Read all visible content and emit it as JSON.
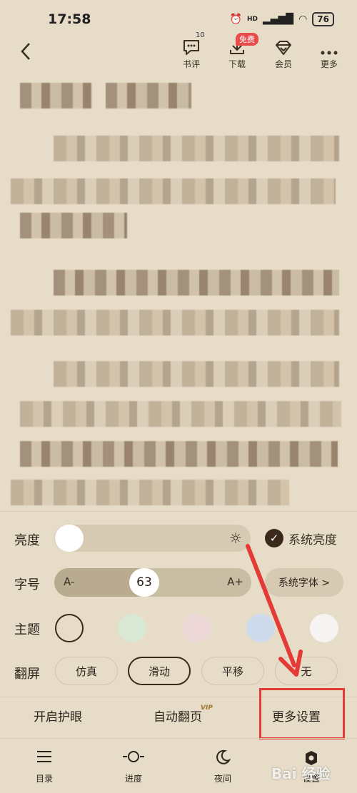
{
  "status_bar": {
    "time": "17:58",
    "alarm_icon": "alarm-icon",
    "hd_label": "HD",
    "signal_icon": "signal-icon",
    "wifi_icon": "wifi-icon",
    "battery": "76"
  },
  "header": {
    "back_icon": "chevron-left-icon",
    "buttons": [
      {
        "label": "书评",
        "icon": "comment-icon",
        "badge": "10"
      },
      {
        "label": "下载",
        "icon": "download-icon",
        "badge": "免费"
      },
      {
        "label": "会员",
        "icon": "diamond-icon"
      },
      {
        "label": "更多",
        "icon": "more-dots-icon"
      }
    ]
  },
  "settings": {
    "brightness": {
      "label": "亮度",
      "level": 0.0,
      "system_label": "系统亮度",
      "system_checked": true
    },
    "font_size": {
      "label": "字号",
      "minus": "A-",
      "plus": "A+",
      "value": "63",
      "font_button": "系统字体 >"
    },
    "theme": {
      "label": "主题",
      "colors": [
        "#e6dcc8",
        "#d8e8d2",
        "#ecd6d6",
        "#cddbec",
        "#f5f4f2"
      ],
      "selected": 0
    },
    "page_turn": {
      "label": "翻屏",
      "options": [
        "仿真",
        "滑动",
        "平移",
        "无"
      ],
      "selected": 1
    }
  },
  "actions": {
    "eye_care": "开启护眼",
    "auto_page": "自动翻页",
    "vip": "VIP",
    "more_settings": "更多设置"
  },
  "bottom_nav": [
    {
      "label": "目录",
      "icon": "menu-lines-icon"
    },
    {
      "label": "进度",
      "icon": "progress-icon"
    },
    {
      "label": "夜间",
      "icon": "moon-icon"
    },
    {
      "label": "设置",
      "icon": "settings-icon"
    }
  ],
  "watermark": "Bai 经验"
}
